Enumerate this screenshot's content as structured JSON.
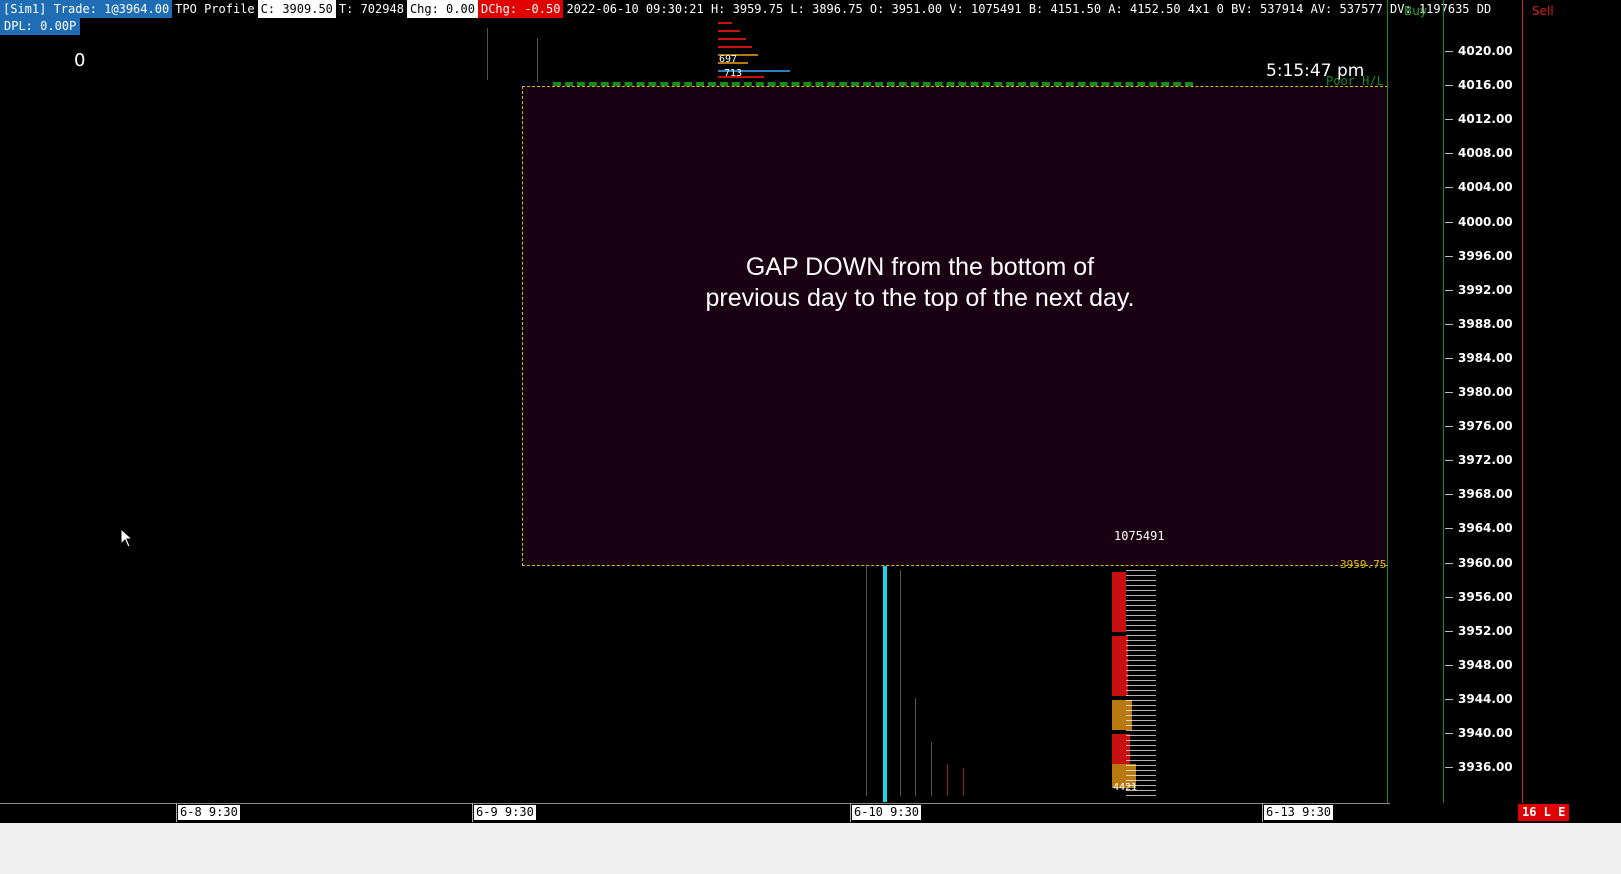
{
  "header": {
    "account_trade": "[Sim1]  Trade: 1@3964.00",
    "study": "TPO Profile",
    "close": "C: 3909.50",
    "t": "T: 702948",
    "chg": "Chg: 0.00",
    "dchg": "DChg: -0.50",
    "stats": "2022-06-10 09:30:21 H: 3959.75 L: 3896.75 O: 3951.00 V: 1075491 B: 4151.50 A: 4152.50 4x1 0 BV: 537914 AV: 537577 DV: 1197635 DD"
  },
  "dpl": "DPL: 0.00P",
  "zero_label": "0",
  "clock": "5:15:47 pm",
  "poor_hl": "Poor H/L",
  "gap_annotation": "GAP DOWN from the bottom of previous day to the top of the next day.",
  "level_label": "3959.75",
  "volume_label": "1075491",
  "panel": {
    "buy": "Buy",
    "sell": "Sell",
    "prices": [
      "4020.00",
      "4016.00",
      "4012.00",
      "4008.00",
      "4004.00",
      "4000.00",
      "3996.00",
      "3992.00",
      "3988.00",
      "3984.00",
      "3980.00",
      "3976.00",
      "3972.00",
      "3968.00",
      "3964.00",
      "3960.00",
      "3956.00",
      "3952.00",
      "3948.00",
      "3944.00",
      "3940.00",
      "3936.00"
    ]
  },
  "axis": {
    "dates": [
      "6-8  9:30",
      "6-9  9:30",
      "6-10  9:30",
      "6-13  9:30"
    ]
  },
  "badge": "16 L E",
  "profile_labels": {
    "top_a": "697",
    "top_b": "713",
    "bot_a": "4421"
  },
  "colors": {
    "accent_blue": "#1e6db5",
    "gap_fill": "#1a0013",
    "level_yellow": "#d4c000",
    "poor_green": "#1a8a1a",
    "cyan_bar": "#17d7e8",
    "profile_red": "#c81010"
  }
}
